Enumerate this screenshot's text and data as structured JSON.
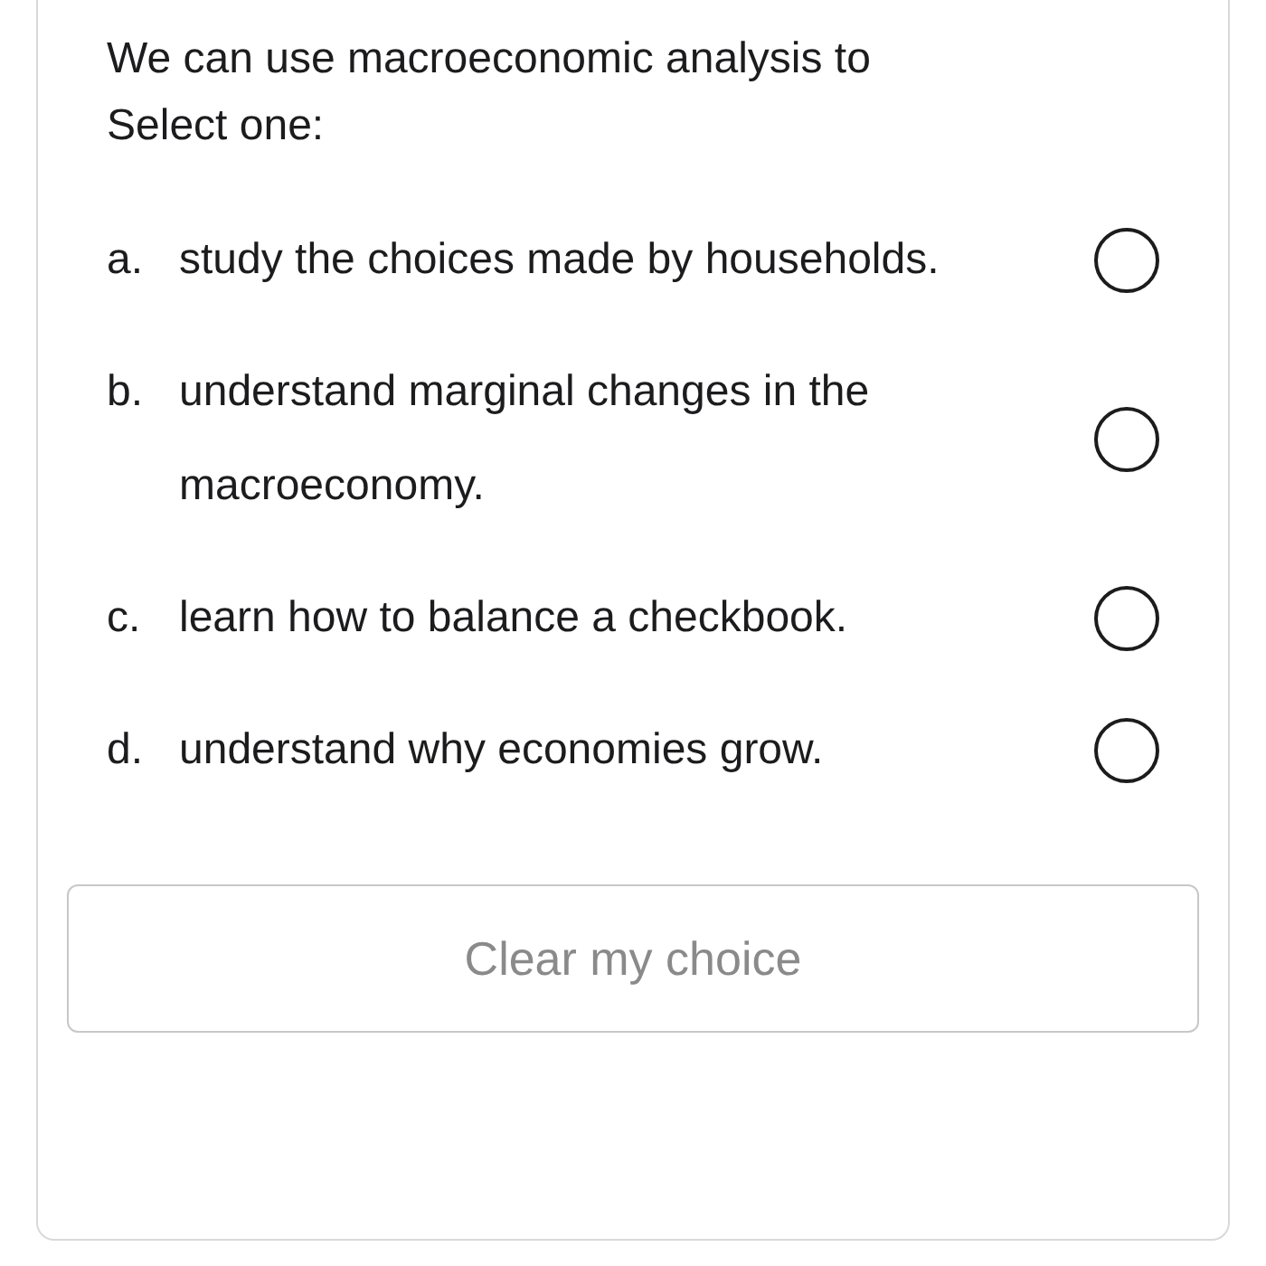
{
  "question": {
    "text": "We can use macroeconomic analysis to",
    "prompt": "Select one:"
  },
  "options": [
    {
      "letter": "a.",
      "text": "study the choices made by households.",
      "selected": false
    },
    {
      "letter": "b.",
      "text": "understand marginal changes in the macroeconomy.",
      "selected": false
    },
    {
      "letter": "c.",
      "text": "learn how to balance a checkbook.",
      "selected": false
    },
    {
      "letter": "d.",
      "text": "understand why economies grow.",
      "selected": false
    }
  ],
  "clear_button": {
    "label": "Clear my choice"
  }
}
